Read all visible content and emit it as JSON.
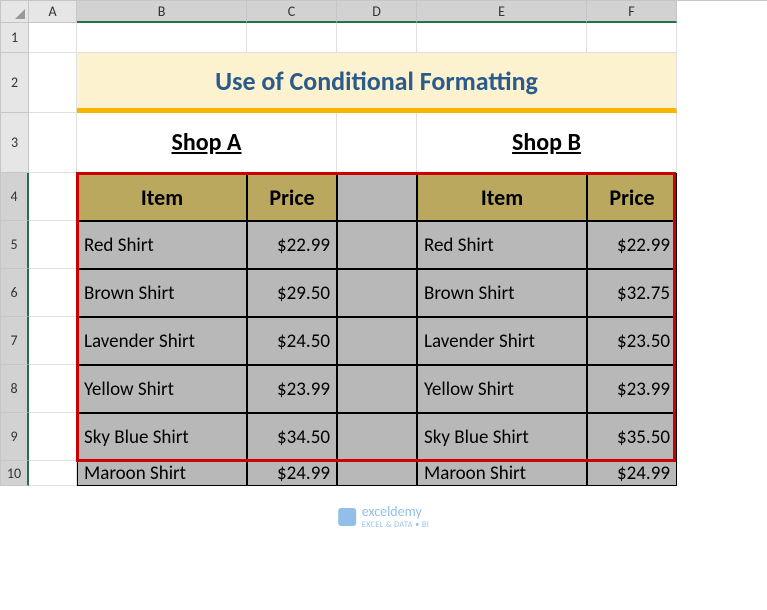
{
  "columns": [
    "A",
    "B",
    "C",
    "D",
    "E",
    "F"
  ],
  "rows": [
    "1",
    "2",
    "3",
    "4",
    "5",
    "6",
    "7",
    "8",
    "9",
    "10"
  ],
  "title": "Use of Conditional Formatting",
  "shop_a_label": "Shop A",
  "shop_b_label": "Shop B",
  "headers": {
    "item": "Item",
    "price": "Price"
  },
  "shop_a": [
    {
      "item": "Red Shirt",
      "price": "$22.99"
    },
    {
      "item": "Brown Shirt",
      "price": "$29.50"
    },
    {
      "item": "Lavender Shirt",
      "price": "$24.50"
    },
    {
      "item": "Yellow Shirt",
      "price": "$23.99"
    },
    {
      "item": "Sky Blue Shirt",
      "price": "$34.50"
    },
    {
      "item": "Maroon Shirt",
      "price": "$24.99"
    }
  ],
  "shop_b": [
    {
      "item": "Red Shirt",
      "price": "$22.99"
    },
    {
      "item": "Brown Shirt",
      "price": "$32.75"
    },
    {
      "item": "Lavender Shirt",
      "price": "$23.50"
    },
    {
      "item": "Yellow Shirt",
      "price": "$23.99"
    },
    {
      "item": "Sky Blue Shirt",
      "price": "$35.50"
    },
    {
      "item": "Maroon Shirt",
      "price": "$24.99"
    }
  ],
  "watermark": {
    "name": "exceldemy",
    "sub": "EXCEL & DATA • BI"
  }
}
